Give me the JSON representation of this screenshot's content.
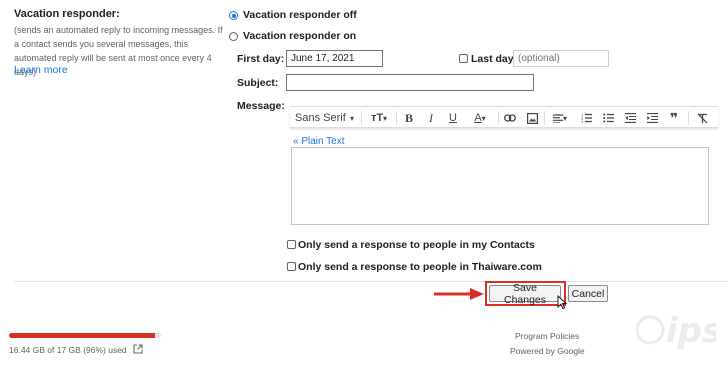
{
  "vacation": {
    "title": "Vacation responder:",
    "description": "(sends an automated reply to incoming messages. If a contact sends you several messages, this automated reply will be sent at most once every 4 days)",
    "learn_more": "Learn more",
    "off_label": "Vacation responder off",
    "on_label": "Vacation responder on",
    "selected": "off"
  },
  "form": {
    "first_day_label": "First day:",
    "first_day_value": "June 17, 2021",
    "last_day_label": "Last day:",
    "last_day_placeholder": "(optional)",
    "subject_label": "Subject:",
    "subject_value": "",
    "message_label": "Message:"
  },
  "toolbar": {
    "font": "Sans Serif",
    "items": [
      "font-size-icon",
      "bold-icon",
      "italic-icon",
      "underline-icon",
      "text-color-icon",
      "link-icon",
      "image-icon",
      "align-icon",
      "numbered-list-icon",
      "bulleted-list-icon",
      "indent-less-icon",
      "indent-more-icon",
      "quote-icon",
      "remove-formatting-icon"
    ]
  },
  "editor": {
    "plain_text_link": "« Plain Text"
  },
  "options": {
    "contacts_only": "Only send a response to people in my Contacts",
    "domain_only": "Only send a response to people in Thaiware.com"
  },
  "actions": {
    "save": "Save Changes",
    "cancel": "Cancel"
  },
  "storage": {
    "used_text": "16.44 GB of 17 GB (96%) used",
    "fraction": 0.96,
    "color": "#d93025"
  },
  "footer": {
    "policies": "Program Policies",
    "powered": "Powered by Google"
  },
  "colors": {
    "accent": "#1a73e8",
    "highlight": "#d93025"
  }
}
